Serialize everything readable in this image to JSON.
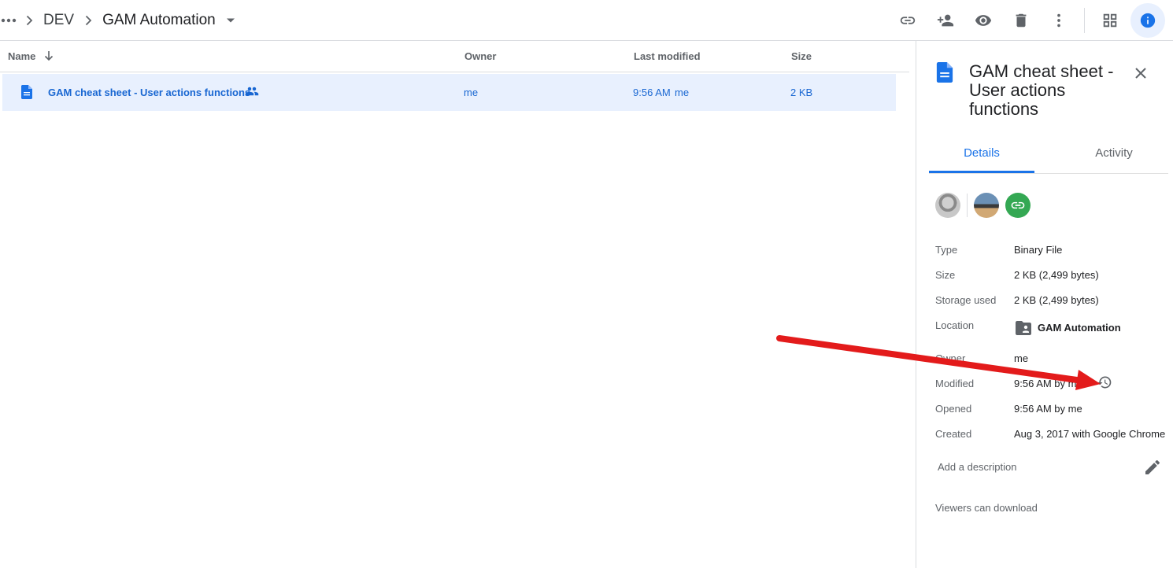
{
  "breadcrumb": {
    "items": [
      "DEV",
      "GAM Automation"
    ]
  },
  "toolbar": {
    "icons": [
      "link-icon",
      "add-person-icon",
      "preview-icon",
      "trash-icon",
      "more-vert-icon",
      "grid-view-icon",
      "info-icon"
    ]
  },
  "list": {
    "headers": {
      "name": "Name",
      "owner": "Owner",
      "modified": "Last modified",
      "size": "Size"
    },
    "rows": [
      {
        "name": "GAM cheat sheet - User actions functions",
        "owner": "me",
        "modified_time": "9:56 AM",
        "modified_by": "me",
        "size": "2 KB"
      }
    ]
  },
  "details": {
    "title": "GAM cheat sheet - User actions functions",
    "tabs": [
      "Details",
      "Activity"
    ],
    "properties": {
      "type_label": "Type",
      "type_value": "Binary File",
      "size_label": "Size",
      "size_value": "2 KB (2,499 bytes)",
      "storage_label": "Storage used",
      "storage_value": "2 KB (2,499 bytes)",
      "location_label": "Location",
      "location_value": "GAM Automation",
      "owner_label": "Owner",
      "owner_value": "me",
      "modified_label": "Modified",
      "modified_value": "9:56 AM by me",
      "opened_label": "Opened",
      "opened_value": "9:56 AM by me",
      "created_label": "Created",
      "created_value": "Aug 3, 2017 with Google Chrome"
    },
    "description_placeholder": "Add a description",
    "viewers_text": "Viewers can download"
  },
  "colors": {
    "accent": "#1a73e8",
    "selected_row": "#e8f0fe",
    "annotation": "#e31b1b"
  }
}
